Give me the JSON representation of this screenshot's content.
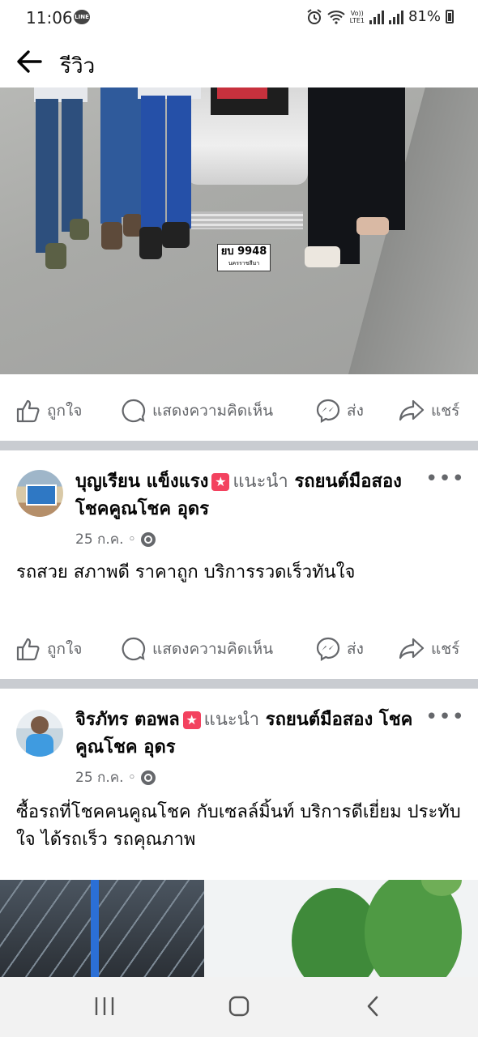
{
  "status_bar": {
    "time": "11:06",
    "line_badge": "LINE",
    "volte_top": "Vo))",
    "volte_bottom": "LTE1",
    "battery": "81%"
  },
  "app_bar": {
    "title": "รีวิว",
    "back_icon": "arrow-left-icon"
  },
  "photo_1": {
    "plate_text": "ยบ 9948",
    "plate_sub": "นครราชสีมา"
  },
  "actions": {
    "like": "ถูกใจ",
    "comment": "แสดงความคิดเห็น",
    "send": "ส่ง",
    "share": "แชร์"
  },
  "posts": [
    {
      "author": "บุญเรียน แข็งแรง",
      "recommends": "แนะนำ",
      "page": "รถยนต์มือสอง โชคคูณโชค อุดร",
      "date": "25 ก.ค. ◦",
      "text": "รถสวย สภาพดี ราคาถูก บริการรวดเร็วทันใจ"
    },
    {
      "author": "จิรภัทร ตอพล",
      "recommends": "แนะนำ",
      "page": "รถยนต์มือสอง โชคคูณโชค อุดร",
      "date": "25 ก.ค. ◦",
      "text": "ซื้อรถที่โชคคนคูณโชค กับเซลล์มิ้นท์ บริการดีเยี่ยม ประทับใจ ได้รถเร็ว รถคุณภาพ"
    }
  ],
  "icons": {
    "more": "more-horizontal-icon",
    "globe": "globe-icon",
    "star": "recommend-star-icon"
  },
  "colors": {
    "text_secondary": "#65676b",
    "separator": "#c9ccd1",
    "recommend_badge": "#f3425f"
  }
}
